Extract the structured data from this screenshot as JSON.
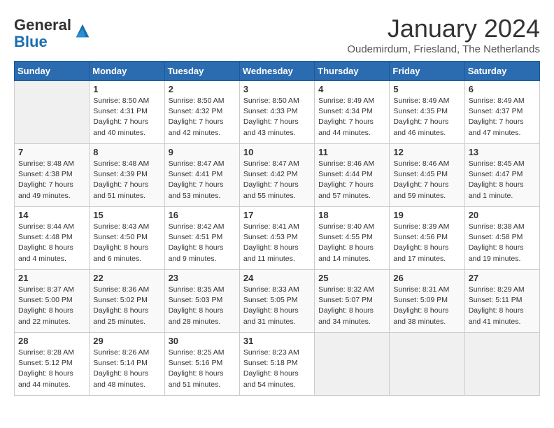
{
  "header": {
    "logo_general": "General",
    "logo_blue": "Blue",
    "month_title": "January 2024",
    "location": "Oudemirdum, Friesland, The Netherlands"
  },
  "days_of_week": [
    "Sunday",
    "Monday",
    "Tuesday",
    "Wednesday",
    "Thursday",
    "Friday",
    "Saturday"
  ],
  "weeks": [
    [
      {
        "day": "",
        "sunrise": "",
        "sunset": "",
        "daylight": "",
        "empty": true
      },
      {
        "day": "1",
        "sunrise": "Sunrise: 8:50 AM",
        "sunset": "Sunset: 4:31 PM",
        "daylight": "Daylight: 7 hours and 40 minutes."
      },
      {
        "day": "2",
        "sunrise": "Sunrise: 8:50 AM",
        "sunset": "Sunset: 4:32 PM",
        "daylight": "Daylight: 7 hours and 42 minutes."
      },
      {
        "day": "3",
        "sunrise": "Sunrise: 8:50 AM",
        "sunset": "Sunset: 4:33 PM",
        "daylight": "Daylight: 7 hours and 43 minutes."
      },
      {
        "day": "4",
        "sunrise": "Sunrise: 8:49 AM",
        "sunset": "Sunset: 4:34 PM",
        "daylight": "Daylight: 7 hours and 44 minutes."
      },
      {
        "day": "5",
        "sunrise": "Sunrise: 8:49 AM",
        "sunset": "Sunset: 4:35 PM",
        "daylight": "Daylight: 7 hours and 46 minutes."
      },
      {
        "day": "6",
        "sunrise": "Sunrise: 8:49 AM",
        "sunset": "Sunset: 4:37 PM",
        "daylight": "Daylight: 7 hours and 47 minutes."
      }
    ],
    [
      {
        "day": "7",
        "sunrise": "Sunrise: 8:48 AM",
        "sunset": "Sunset: 4:38 PM",
        "daylight": "Daylight: 7 hours and 49 minutes."
      },
      {
        "day": "8",
        "sunrise": "Sunrise: 8:48 AM",
        "sunset": "Sunset: 4:39 PM",
        "daylight": "Daylight: 7 hours and 51 minutes."
      },
      {
        "day": "9",
        "sunrise": "Sunrise: 8:47 AM",
        "sunset": "Sunset: 4:41 PM",
        "daylight": "Daylight: 7 hours and 53 minutes."
      },
      {
        "day": "10",
        "sunrise": "Sunrise: 8:47 AM",
        "sunset": "Sunset: 4:42 PM",
        "daylight": "Daylight: 7 hours and 55 minutes."
      },
      {
        "day": "11",
        "sunrise": "Sunrise: 8:46 AM",
        "sunset": "Sunset: 4:44 PM",
        "daylight": "Daylight: 7 hours and 57 minutes."
      },
      {
        "day": "12",
        "sunrise": "Sunrise: 8:46 AM",
        "sunset": "Sunset: 4:45 PM",
        "daylight": "Daylight: 7 hours and 59 minutes."
      },
      {
        "day": "13",
        "sunrise": "Sunrise: 8:45 AM",
        "sunset": "Sunset: 4:47 PM",
        "daylight": "Daylight: 8 hours and 1 minute."
      }
    ],
    [
      {
        "day": "14",
        "sunrise": "Sunrise: 8:44 AM",
        "sunset": "Sunset: 4:48 PM",
        "daylight": "Daylight: 8 hours and 4 minutes."
      },
      {
        "day": "15",
        "sunrise": "Sunrise: 8:43 AM",
        "sunset": "Sunset: 4:50 PM",
        "daylight": "Daylight: 8 hours and 6 minutes."
      },
      {
        "day": "16",
        "sunrise": "Sunrise: 8:42 AM",
        "sunset": "Sunset: 4:51 PM",
        "daylight": "Daylight: 8 hours and 9 minutes."
      },
      {
        "day": "17",
        "sunrise": "Sunrise: 8:41 AM",
        "sunset": "Sunset: 4:53 PM",
        "daylight": "Daylight: 8 hours and 11 minutes."
      },
      {
        "day": "18",
        "sunrise": "Sunrise: 8:40 AM",
        "sunset": "Sunset: 4:55 PM",
        "daylight": "Daylight: 8 hours and 14 minutes."
      },
      {
        "day": "19",
        "sunrise": "Sunrise: 8:39 AM",
        "sunset": "Sunset: 4:56 PM",
        "daylight": "Daylight: 8 hours and 17 minutes."
      },
      {
        "day": "20",
        "sunrise": "Sunrise: 8:38 AM",
        "sunset": "Sunset: 4:58 PM",
        "daylight": "Daylight: 8 hours and 19 minutes."
      }
    ],
    [
      {
        "day": "21",
        "sunrise": "Sunrise: 8:37 AM",
        "sunset": "Sunset: 5:00 PM",
        "daylight": "Daylight: 8 hours and 22 minutes."
      },
      {
        "day": "22",
        "sunrise": "Sunrise: 8:36 AM",
        "sunset": "Sunset: 5:02 PM",
        "daylight": "Daylight: 8 hours and 25 minutes."
      },
      {
        "day": "23",
        "sunrise": "Sunrise: 8:35 AM",
        "sunset": "Sunset: 5:03 PM",
        "daylight": "Daylight: 8 hours and 28 minutes."
      },
      {
        "day": "24",
        "sunrise": "Sunrise: 8:33 AM",
        "sunset": "Sunset: 5:05 PM",
        "daylight": "Daylight: 8 hours and 31 minutes."
      },
      {
        "day": "25",
        "sunrise": "Sunrise: 8:32 AM",
        "sunset": "Sunset: 5:07 PM",
        "daylight": "Daylight: 8 hours and 34 minutes."
      },
      {
        "day": "26",
        "sunrise": "Sunrise: 8:31 AM",
        "sunset": "Sunset: 5:09 PM",
        "daylight": "Daylight: 8 hours and 38 minutes."
      },
      {
        "day": "27",
        "sunrise": "Sunrise: 8:29 AM",
        "sunset": "Sunset: 5:11 PM",
        "daylight": "Daylight: 8 hours and 41 minutes."
      }
    ],
    [
      {
        "day": "28",
        "sunrise": "Sunrise: 8:28 AM",
        "sunset": "Sunset: 5:12 PM",
        "daylight": "Daylight: 8 hours and 44 minutes."
      },
      {
        "day": "29",
        "sunrise": "Sunrise: 8:26 AM",
        "sunset": "Sunset: 5:14 PM",
        "daylight": "Daylight: 8 hours and 48 minutes."
      },
      {
        "day": "30",
        "sunrise": "Sunrise: 8:25 AM",
        "sunset": "Sunset: 5:16 PM",
        "daylight": "Daylight: 8 hours and 51 minutes."
      },
      {
        "day": "31",
        "sunrise": "Sunrise: 8:23 AM",
        "sunset": "Sunset: 5:18 PM",
        "daylight": "Daylight: 8 hours and 54 minutes."
      },
      {
        "day": "",
        "sunrise": "",
        "sunset": "",
        "daylight": "",
        "empty": true
      },
      {
        "day": "",
        "sunrise": "",
        "sunset": "",
        "daylight": "",
        "empty": true
      },
      {
        "day": "",
        "sunrise": "",
        "sunset": "",
        "daylight": "",
        "empty": true
      }
    ]
  ]
}
